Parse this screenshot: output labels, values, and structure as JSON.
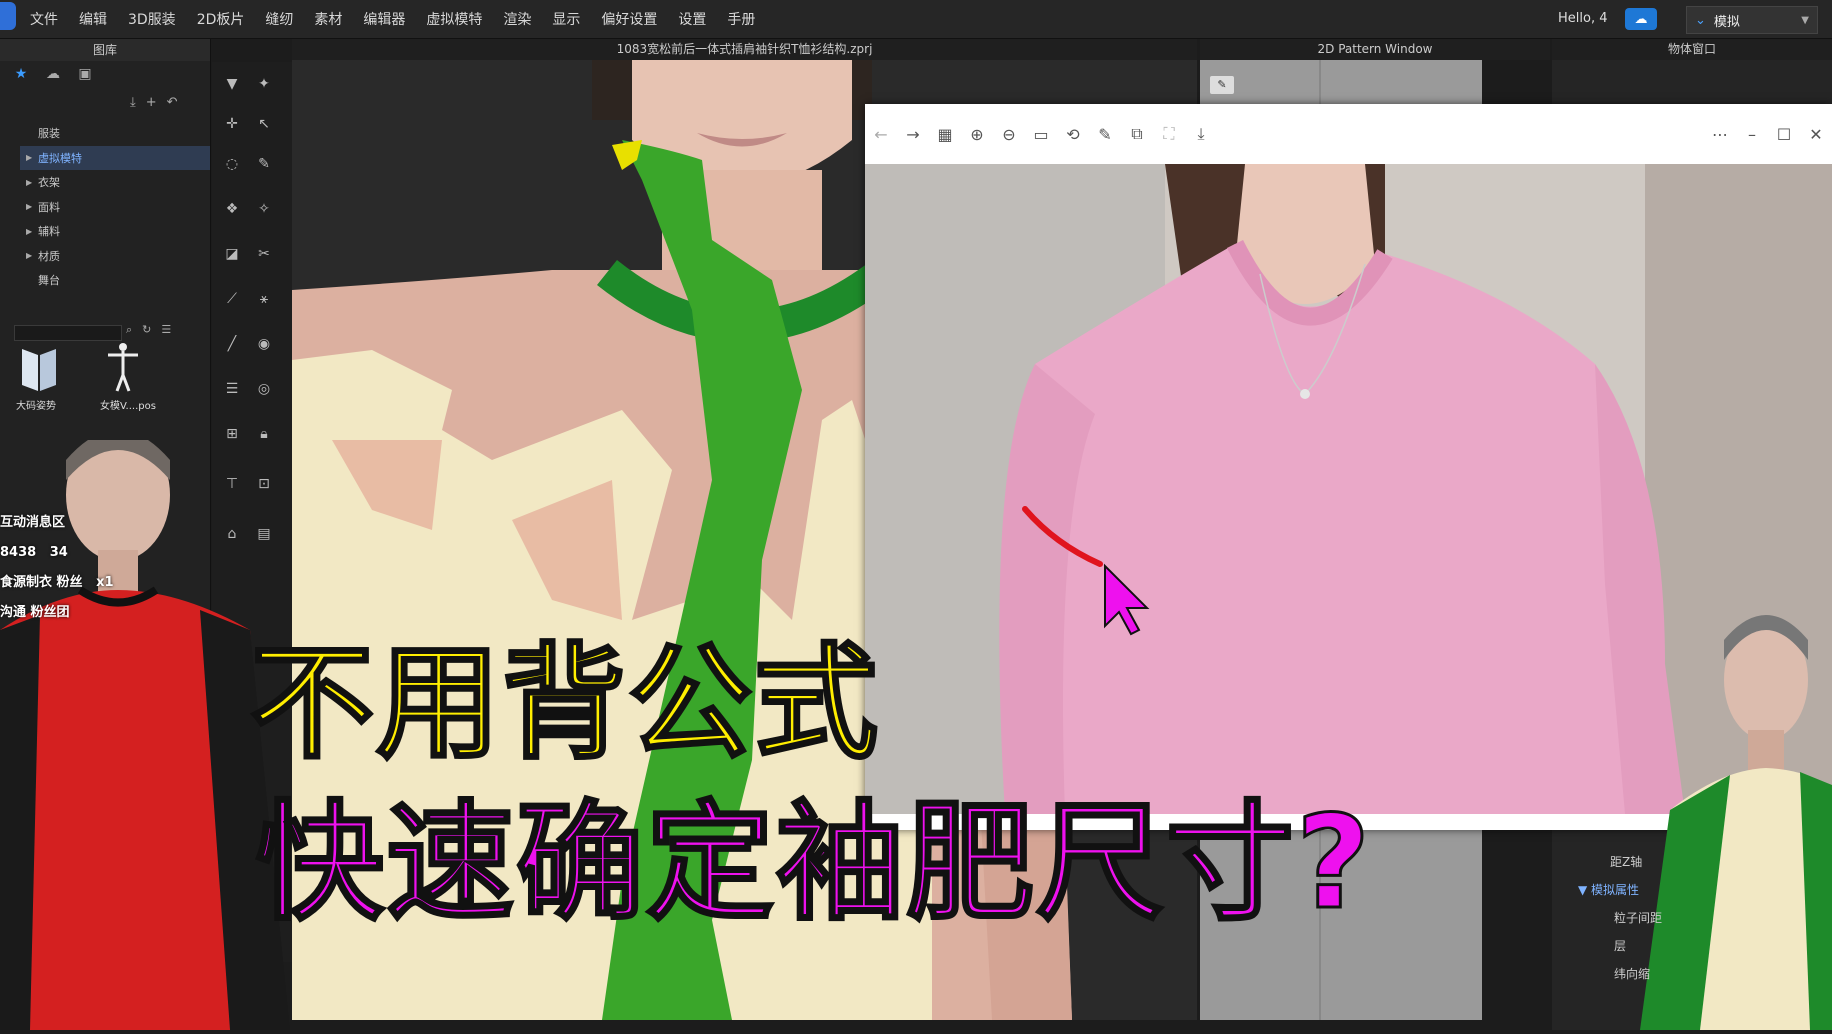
{
  "menubar": {
    "items": [
      "文件",
      "编辑",
      "3D服装",
      "2D板片",
      "缝纫",
      "素材",
      "编辑器",
      "虚拟模特",
      "渲染",
      "显示",
      "偏好设置",
      "设置",
      "手册"
    ],
    "hello": "Hello, 4",
    "mode": "模拟"
  },
  "library": {
    "title": "图库",
    "tree": [
      {
        "label": "服装",
        "caret": false,
        "selected": false
      },
      {
        "label": "虚拟模特",
        "caret": true,
        "selected": true
      },
      {
        "label": "衣架",
        "caret": true,
        "selected": false
      },
      {
        "label": "面料",
        "caret": true,
        "selected": false
      },
      {
        "label": "辅料",
        "caret": true,
        "selected": false
      },
      {
        "label": "材质",
        "caret": true,
        "selected": false
      },
      {
        "label": "舞台",
        "caret": false,
        "selected": false
      }
    ],
    "thumbnails": [
      "大码姿势",
      "女模V....pos"
    ]
  },
  "viewport": {
    "title": "1083宽松前后一体式插肩袖针织T恤衫结构.zprj"
  },
  "pattern_window": {
    "title": "2D Pattern Window"
  },
  "object_window": {
    "title": "物体窗口",
    "labels": [
      "距Z轴",
      "模拟属性",
      "粒子间距",
      "层",
      "纬向缩"
    ]
  },
  "left_info": {
    "lines": [
      "互动消息区",
      "8438",
      "34",
      "食源制衣",
      "粉丝",
      "沟通",
      "粉丝团"
    ],
    "badge": "x1"
  },
  "captions": {
    "top": "不用背公式",
    "bottom": "快速确定袖肥尺寸?"
  },
  "colors": {
    "accent": "#3b9cff",
    "caption_top": "#ffee00",
    "caption_bottom": "#ee11ee",
    "sweater_pink": "#eaa8c8",
    "neck_green": "#1e8a2a"
  }
}
